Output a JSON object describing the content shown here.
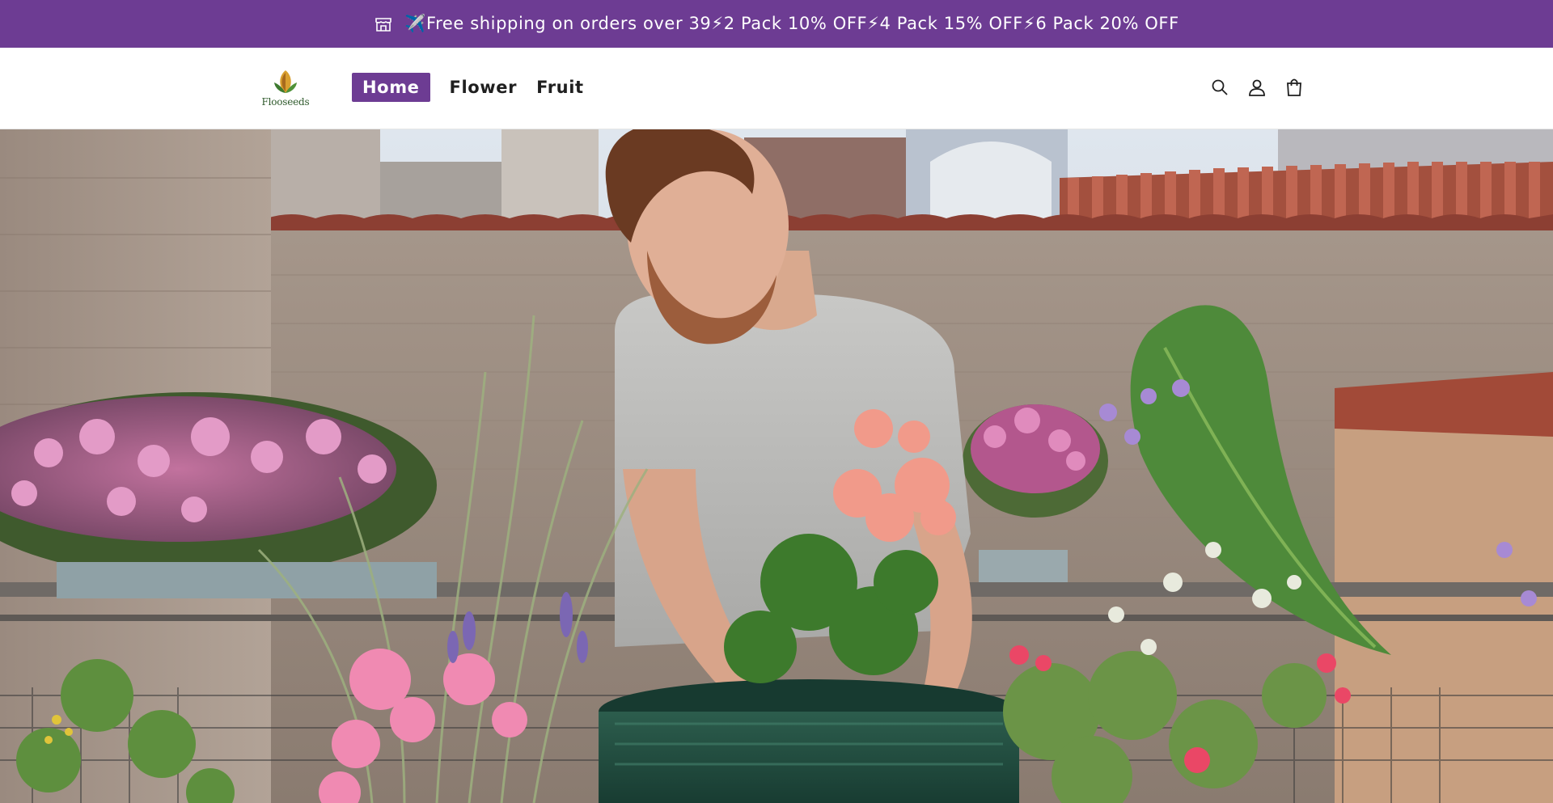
{
  "announcement": {
    "text": "✈️Free shipping on orders over 39⚡2 Pack 10% OFF⚡4 Pack 15% OFF⚡6 Pack 20% OFF",
    "background": "#6d3c93",
    "icon": "store-icon"
  },
  "header": {
    "logo": {
      "text": "Flooseeds",
      "icon": "leaf-logo"
    },
    "nav": [
      {
        "label": "Home",
        "active": true
      },
      {
        "label": "Flower",
        "active": false
      },
      {
        "label": "Fruit",
        "active": false
      }
    ],
    "icons": [
      "search-icon",
      "account-icon",
      "cart-icon"
    ],
    "accent_color": "#6d3c93"
  },
  "hero": {
    "image": "man-gardening-rooftop-photo"
  }
}
